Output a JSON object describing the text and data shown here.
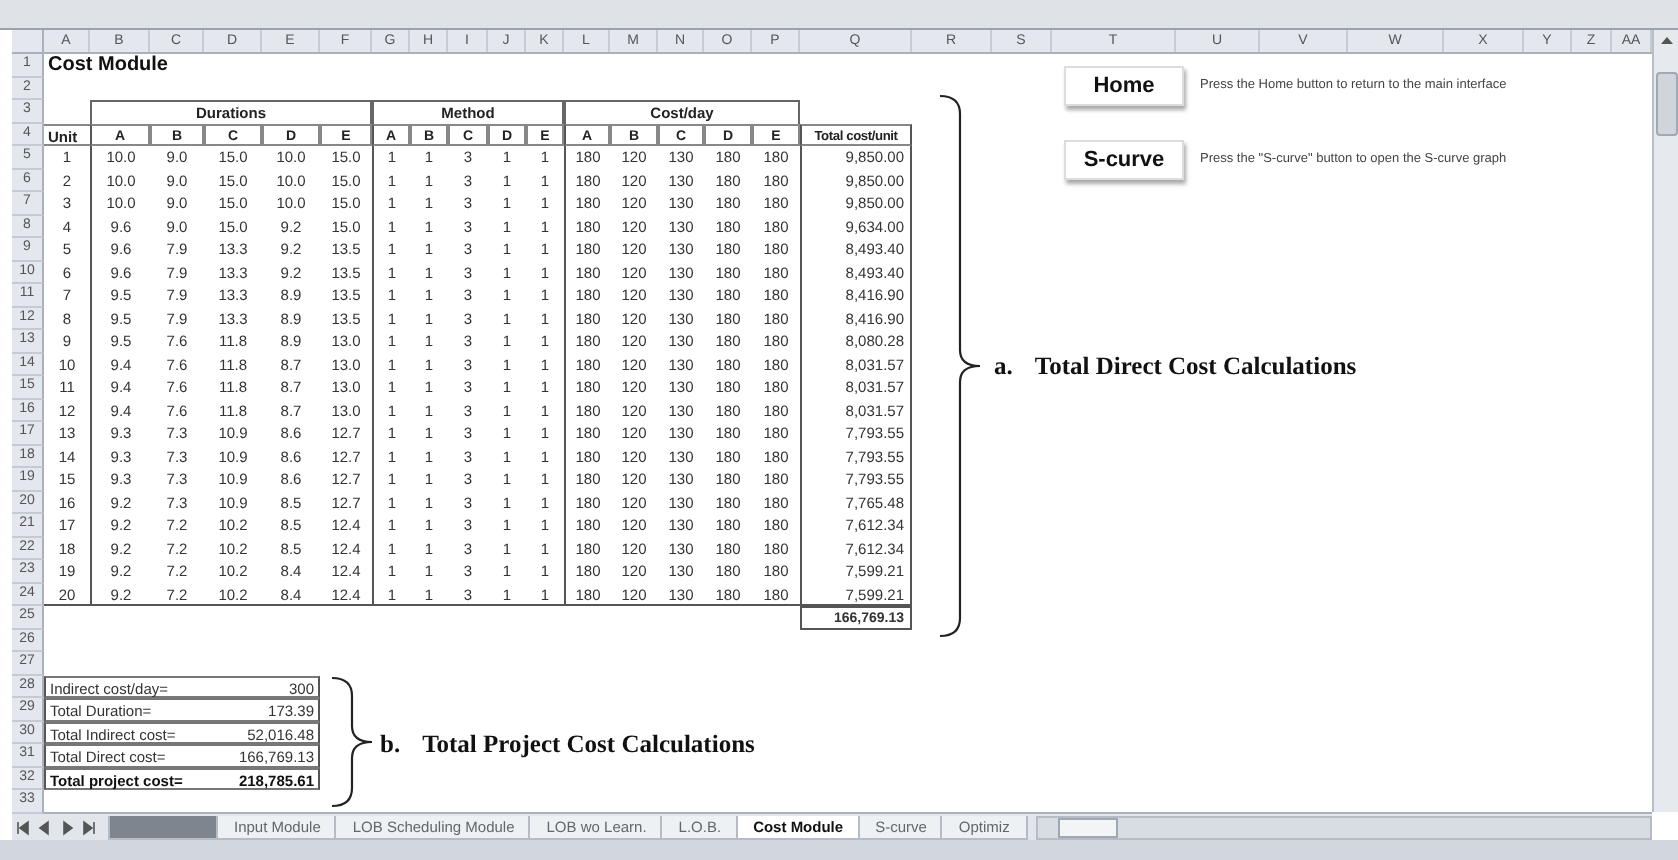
{
  "sheet": {
    "columns": [
      "A",
      "B",
      "C",
      "D",
      "E",
      "F",
      "G",
      "H",
      "I",
      "J",
      "K",
      "L",
      "M",
      "N",
      "O",
      "P",
      "Q",
      "R",
      "S",
      "T",
      "U",
      "V",
      "W",
      "X",
      "Y",
      "Z",
      "AA"
    ],
    "rows": [
      "1",
      "2",
      "3",
      "4",
      "5",
      "6",
      "7",
      "8",
      "9",
      "10",
      "11",
      "12",
      "13",
      "14",
      "15",
      "16",
      "17",
      "18",
      "19",
      "20",
      "21",
      "22",
      "23",
      "24",
      "25",
      "26",
      "27",
      "28",
      "29",
      "30",
      "31",
      "32",
      "33"
    ]
  },
  "title": "Cost Module",
  "cost_table": {
    "groups": [
      {
        "label": "Durations",
        "columns": [
          "A",
          "B",
          "C",
          "D",
          "E"
        ]
      },
      {
        "label": "Method",
        "columns": [
          "A",
          "B",
          "C",
          "D",
          "E"
        ]
      },
      {
        "label": "Cost/day",
        "columns": [
          "A",
          "B",
          "C",
          "D",
          "E"
        ]
      }
    ],
    "unit_header": "Unit",
    "total_header": "Total cost/unit",
    "rows": [
      {
        "unit": "1",
        "durations": [
          "10.0",
          "9.0",
          "15.0",
          "10.0",
          "15.0"
        ],
        "method": [
          "1",
          "1",
          "3",
          "1",
          "1"
        ],
        "cost": [
          "180",
          "120",
          "130",
          "180",
          "180"
        ],
        "total": "9,850.00"
      },
      {
        "unit": "2",
        "durations": [
          "10.0",
          "9.0",
          "15.0",
          "10.0",
          "15.0"
        ],
        "method": [
          "1",
          "1",
          "3",
          "1",
          "1"
        ],
        "cost": [
          "180",
          "120",
          "130",
          "180",
          "180"
        ],
        "total": "9,850.00"
      },
      {
        "unit": "3",
        "durations": [
          "10.0",
          "9.0",
          "15.0",
          "10.0",
          "15.0"
        ],
        "method": [
          "1",
          "1",
          "3",
          "1",
          "1"
        ],
        "cost": [
          "180",
          "120",
          "130",
          "180",
          "180"
        ],
        "total": "9,850.00"
      },
      {
        "unit": "4",
        "durations": [
          "9.6",
          "9.0",
          "15.0",
          "9.2",
          "15.0"
        ],
        "method": [
          "1",
          "1",
          "3",
          "1",
          "1"
        ],
        "cost": [
          "180",
          "120",
          "130",
          "180",
          "180"
        ],
        "total": "9,634.00"
      },
      {
        "unit": "5",
        "durations": [
          "9.6",
          "7.9",
          "13.3",
          "9.2",
          "13.5"
        ],
        "method": [
          "1",
          "1",
          "3",
          "1",
          "1"
        ],
        "cost": [
          "180",
          "120",
          "130",
          "180",
          "180"
        ],
        "total": "8,493.40"
      },
      {
        "unit": "6",
        "durations": [
          "9.6",
          "7.9",
          "13.3",
          "9.2",
          "13.5"
        ],
        "method": [
          "1",
          "1",
          "3",
          "1",
          "1"
        ],
        "cost": [
          "180",
          "120",
          "130",
          "180",
          "180"
        ],
        "total": "8,493.40"
      },
      {
        "unit": "7",
        "durations": [
          "9.5",
          "7.9",
          "13.3",
          "8.9",
          "13.5"
        ],
        "method": [
          "1",
          "1",
          "3",
          "1",
          "1"
        ],
        "cost": [
          "180",
          "120",
          "130",
          "180",
          "180"
        ],
        "total": "8,416.90"
      },
      {
        "unit": "8",
        "durations": [
          "9.5",
          "7.9",
          "13.3",
          "8.9",
          "13.5"
        ],
        "method": [
          "1",
          "1",
          "3",
          "1",
          "1"
        ],
        "cost": [
          "180",
          "120",
          "130",
          "180",
          "180"
        ],
        "total": "8,416.90"
      },
      {
        "unit": "9",
        "durations": [
          "9.5",
          "7.6",
          "11.8",
          "8.9",
          "13.0"
        ],
        "method": [
          "1",
          "1",
          "3",
          "1",
          "1"
        ],
        "cost": [
          "180",
          "120",
          "130",
          "180",
          "180"
        ],
        "total": "8,080.28"
      },
      {
        "unit": "10",
        "durations": [
          "9.4",
          "7.6",
          "11.8",
          "8.7",
          "13.0"
        ],
        "method": [
          "1",
          "1",
          "3",
          "1",
          "1"
        ],
        "cost": [
          "180",
          "120",
          "130",
          "180",
          "180"
        ],
        "total": "8,031.57"
      },
      {
        "unit": "11",
        "durations": [
          "9.4",
          "7.6",
          "11.8",
          "8.7",
          "13.0"
        ],
        "method": [
          "1",
          "1",
          "3",
          "1",
          "1"
        ],
        "cost": [
          "180",
          "120",
          "130",
          "180",
          "180"
        ],
        "total": "8,031.57"
      },
      {
        "unit": "12",
        "durations": [
          "9.4",
          "7.6",
          "11.8",
          "8.7",
          "13.0"
        ],
        "method": [
          "1",
          "1",
          "3",
          "1",
          "1"
        ],
        "cost": [
          "180",
          "120",
          "130",
          "180",
          "180"
        ],
        "total": "8,031.57"
      },
      {
        "unit": "13",
        "durations": [
          "9.3",
          "7.3",
          "10.9",
          "8.6",
          "12.7"
        ],
        "method": [
          "1",
          "1",
          "3",
          "1",
          "1"
        ],
        "cost": [
          "180",
          "120",
          "130",
          "180",
          "180"
        ],
        "total": "7,793.55"
      },
      {
        "unit": "14",
        "durations": [
          "9.3",
          "7.3",
          "10.9",
          "8.6",
          "12.7"
        ],
        "method": [
          "1",
          "1",
          "3",
          "1",
          "1"
        ],
        "cost": [
          "180",
          "120",
          "130",
          "180",
          "180"
        ],
        "total": "7,793.55"
      },
      {
        "unit": "15",
        "durations": [
          "9.3",
          "7.3",
          "10.9",
          "8.6",
          "12.7"
        ],
        "method": [
          "1",
          "1",
          "3",
          "1",
          "1"
        ],
        "cost": [
          "180",
          "120",
          "130",
          "180",
          "180"
        ],
        "total": "7,793.55"
      },
      {
        "unit": "16",
        "durations": [
          "9.2",
          "7.3",
          "10.9",
          "8.5",
          "12.7"
        ],
        "method": [
          "1",
          "1",
          "3",
          "1",
          "1"
        ],
        "cost": [
          "180",
          "120",
          "130",
          "180",
          "180"
        ],
        "total": "7,765.48"
      },
      {
        "unit": "17",
        "durations": [
          "9.2",
          "7.2",
          "10.2",
          "8.5",
          "12.4"
        ],
        "method": [
          "1",
          "1",
          "3",
          "1",
          "1"
        ],
        "cost": [
          "180",
          "120",
          "130",
          "180",
          "180"
        ],
        "total": "7,612.34"
      },
      {
        "unit": "18",
        "durations": [
          "9.2",
          "7.2",
          "10.2",
          "8.5",
          "12.4"
        ],
        "method": [
          "1",
          "1",
          "3",
          "1",
          "1"
        ],
        "cost": [
          "180",
          "120",
          "130",
          "180",
          "180"
        ],
        "total": "7,612.34"
      },
      {
        "unit": "19",
        "durations": [
          "9.2",
          "7.2",
          "10.2",
          "8.4",
          "12.4"
        ],
        "method": [
          "1",
          "1",
          "3",
          "1",
          "1"
        ],
        "cost": [
          "180",
          "120",
          "130",
          "180",
          "180"
        ],
        "total": "7,599.21"
      },
      {
        "unit": "20",
        "durations": [
          "9.2",
          "7.2",
          "10.2",
          "8.4",
          "12.4"
        ],
        "method": [
          "1",
          "1",
          "3",
          "1",
          "1"
        ],
        "cost": [
          "180",
          "120",
          "130",
          "180",
          "180"
        ],
        "total": "7,599.21"
      }
    ],
    "grand_total": "166,769.13"
  },
  "summary": [
    {
      "label": "Indirect cost/day=",
      "value": "300",
      "bold": false
    },
    {
      "label": "Total Duration=",
      "value": "173.39",
      "bold": false
    },
    {
      "label": "Total Indirect cost=",
      "value": "52,016.48",
      "bold": false
    },
    {
      "label": "Total Direct cost=",
      "value": "166,769.13",
      "bold": false
    },
    {
      "label": "Total project cost=",
      "value": "218,785.61",
      "bold": true
    }
  ],
  "buttons": [
    {
      "label": "Home",
      "hint": "Press the Home button to return to the main interface"
    },
    {
      "label": "S-curve",
      "hint": "Press the \"S-curve\" button to open the S-curve graph"
    }
  ],
  "annotations": [
    {
      "marker": "a.",
      "text": "Total Direct Cost Calculations"
    },
    {
      "marker": "b.",
      "text": "Total Project Cost Calculations"
    }
  ],
  "sheet_tabs": [
    {
      "kind": "obscured",
      "selected": false
    },
    {
      "kind": "tab",
      "label": "Input Module",
      "selected": false
    },
    {
      "kind": "tab",
      "label": "LOB Scheduling Module",
      "selected": false
    },
    {
      "kind": "tab",
      "label": "LOB wo Learn.",
      "selected": false
    },
    {
      "kind": "tab",
      "label": "L.O.B.",
      "selected": false
    },
    {
      "kind": "tab",
      "label": "Cost Module",
      "selected": true
    },
    {
      "kind": "tab",
      "label": "S-curve",
      "selected": false
    },
    {
      "kind": "tab",
      "label": "Optimiz",
      "selected": false
    }
  ]
}
